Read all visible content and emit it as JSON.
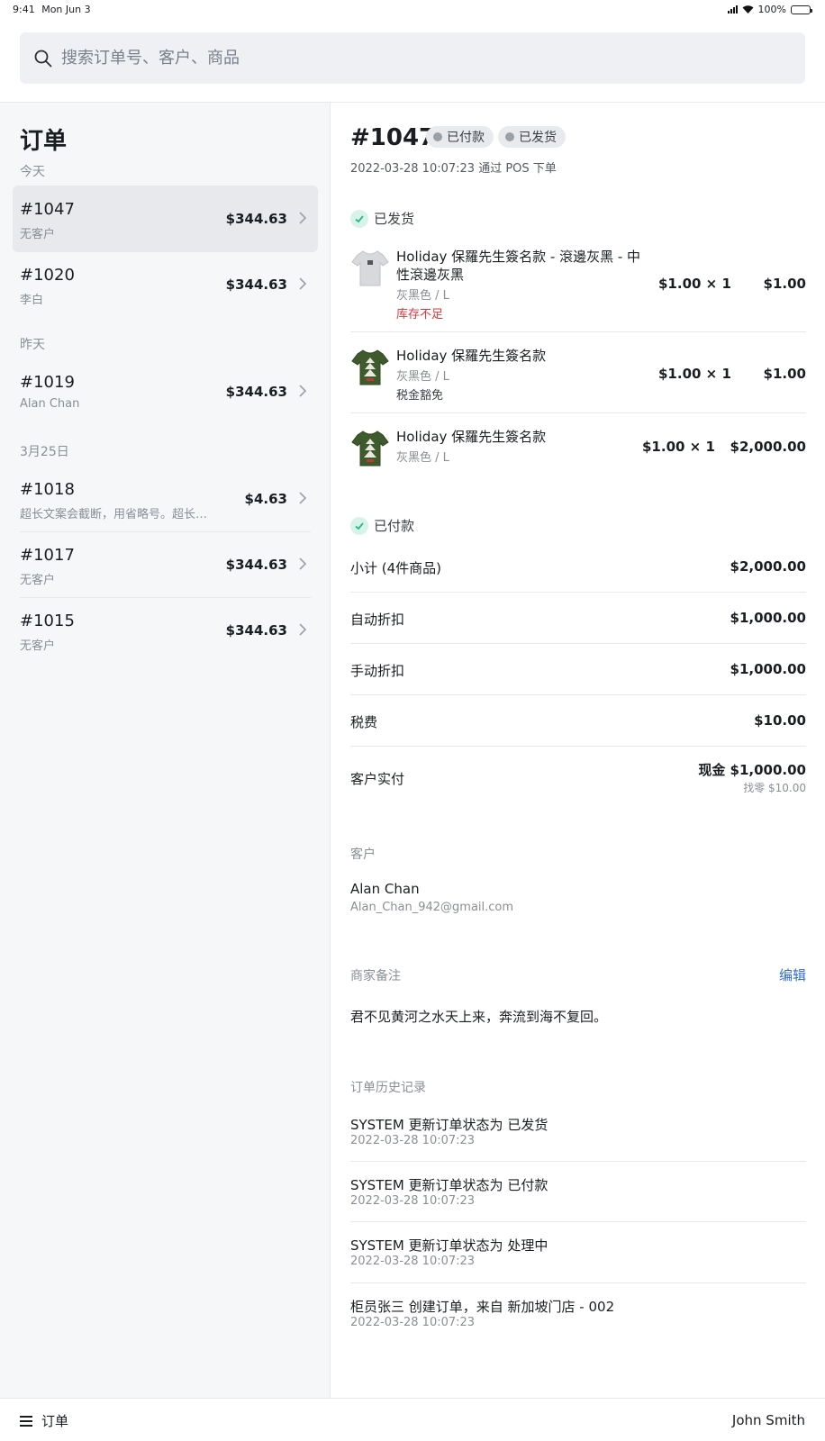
{
  "status_bar": {
    "time": "9:41",
    "date": "Mon Jun 3",
    "battery": "100%"
  },
  "search": {
    "placeholder": "搜索订单号、客户、商品"
  },
  "sidebar": {
    "title": "订单",
    "groups": [
      {
        "label": "今天",
        "orders": [
          {
            "number": "#1047",
            "customer": "无客户",
            "amount": "$344.63",
            "selected": true
          },
          {
            "number": "#1020",
            "customer": "李白",
            "amount": "$344.63"
          }
        ]
      },
      {
        "label": "昨天",
        "orders": [
          {
            "number": "#1019",
            "customer": "Alan Chan",
            "amount": "$344.63"
          }
        ]
      },
      {
        "label": "3月25日",
        "orders": [
          {
            "number": "#1018",
            "customer": "超长文案会截断，用省略号。超长文案...",
            "amount": "$4.63"
          },
          {
            "number": "#1017",
            "customer": "无客户",
            "amount": "$344.63"
          },
          {
            "number": "#1015",
            "customer": "无客户",
            "amount": "$344.63"
          }
        ]
      }
    ]
  },
  "detail": {
    "number": "#1047",
    "badges": [
      "已付款",
      "已发货"
    ],
    "meta": "2022-03-28 10:07:23  通过 POS 下单",
    "shipped_label": "已发货",
    "items": [
      {
        "name": "Holiday 保羅先生簽名款 - 滾邊灰黑 - 中性滾邊灰黑",
        "variant": "灰黑色 / L",
        "extra": "库存不足",
        "qty": "$1.00 × 1",
        "total": "$1.00",
        "thumb_color": "#d7d9dc"
      },
      {
        "name": "Holiday 保羅先生簽名款",
        "variant": "灰黑色 / L",
        "extra": "税金豁免",
        "qty": "$1.00 × 1",
        "total": "$1.00",
        "thumb_color": "#3f5a2c"
      },
      {
        "name": "Holiday 保羅先生簽名款",
        "variant": "灰黑色 / L",
        "extra": "",
        "qty": "$1.00 × 1",
        "total": "$2,000.00",
        "thumb_color": "#3f5a2c"
      }
    ],
    "paid_label": "已付款",
    "summary": [
      {
        "label": "小计 (4件商品)",
        "value": "$2,000.00"
      },
      {
        "label": "自动折扣",
        "value": "$1,000.00"
      },
      {
        "label": "手动折扣",
        "value": "$1,000.00"
      },
      {
        "label": "税费",
        "value": "$10.00"
      }
    ],
    "paid": {
      "label": "客户实付",
      "value": "现金 $1,000.00",
      "change": "找零 $10.00"
    },
    "customer": {
      "label": "客户",
      "name": "Alan Chan",
      "email": "Alan_Chan_942@gmail.com"
    },
    "note": {
      "label": "商家备注",
      "edit": "编辑",
      "text": "君不见黄河之水天上来，奔流到海不复回。"
    },
    "history": {
      "label": "订单历史记录",
      "entries": [
        {
          "title": "SYSTEM 更新订单状态为 已发货",
          "time": "2022-03-28 10:07:23"
        },
        {
          "title": "SYSTEM 更新订单状态为 已付款",
          "time": "2022-03-28 10:07:23"
        },
        {
          "title": "SYSTEM 更新订单状态为 处理中",
          "time": "2022-03-28 10:07:23"
        },
        {
          "title": "柜员张三 创建订单，来自 新加坡门店 - 002",
          "time": "2022-03-28 10:07:23"
        }
      ]
    }
  },
  "bottom_bar": {
    "menu_label": "订单",
    "user": "John Smith"
  },
  "colors": {
    "accent": "#2f6bd8",
    "warning": "#e5323b",
    "success_bg": "#d7f3ea",
    "success": "#2bb58a",
    "selected_row": "#e7e9ec"
  }
}
